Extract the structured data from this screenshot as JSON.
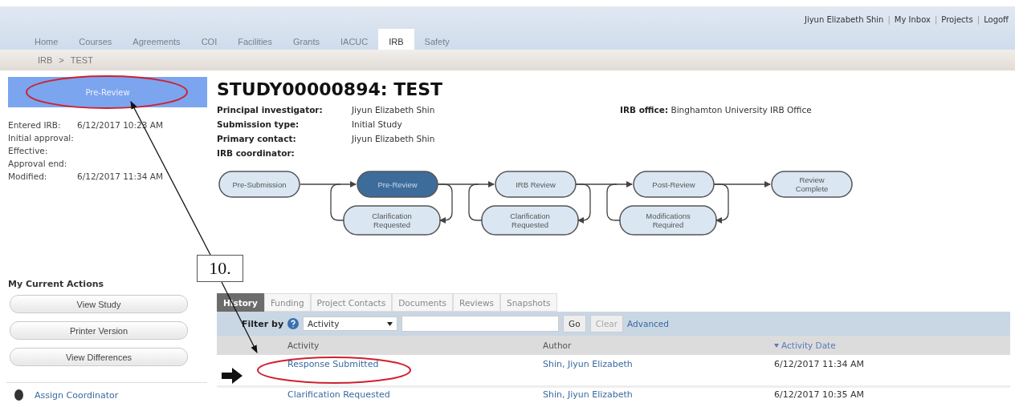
{
  "top_nav": {
    "tabs": [
      {
        "label": "Home",
        "selected": false
      },
      {
        "label": "Courses",
        "selected": false
      },
      {
        "label": "Agreements",
        "selected": false
      },
      {
        "label": "COI",
        "selected": false
      },
      {
        "label": "Facilities",
        "selected": false
      },
      {
        "label": "Grants",
        "selected": false
      },
      {
        "label": "IACUC",
        "selected": false
      },
      {
        "label": "IRB",
        "selected": true
      },
      {
        "label": "Safety",
        "selected": false
      }
    ],
    "user_links": [
      "Jiyun Elizabeth Shin",
      "My Inbox",
      "Projects",
      "Logoff"
    ],
    "link_separator": "|"
  },
  "breadcrumb": {
    "items": [
      "IRB",
      "TEST"
    ],
    "separator": ">"
  },
  "sidebar": {
    "state": "Pre-Review",
    "dates": [
      {
        "label": "Entered IRB:",
        "value": "6/12/2017 10:23 AM"
      },
      {
        "label": "Initial approval:"
      },
      {
        "label": "Effective:"
      },
      {
        "label": "Approval end:"
      },
      {
        "label": "Modified:",
        "value": "6/12/2017 11:34 AM"
      }
    ],
    "actions_title": "My Current Actions",
    "actions": [
      "View Study",
      "Printer Version",
      "View Differences"
    ],
    "activities": [
      "Assign Coordinator"
    ]
  },
  "study": {
    "title": "STUDY00000894: TEST",
    "fields": [
      {
        "label": "Principal investigator:",
        "value": "Jiyun Elizabeth Shin"
      },
      {
        "label": "Submission type:",
        "value": "Initial Study"
      },
      {
        "label": "Primary contact:",
        "value": "Jiyun Elizabeth Shin"
      },
      {
        "label": "IRB coordinator:"
      }
    ],
    "office": {
      "label": "IRB office:",
      "value": "Binghamton University IRB Office"
    }
  },
  "workflow": [
    {
      "label": "Pre-Submission",
      "current": false
    },
    {
      "label": "Pre-Review",
      "current": true,
      "loop": "Clarification Requested"
    },
    {
      "label": "IRB Review",
      "current": false,
      "loop": "Clarification Requested"
    },
    {
      "label": "Post-Review",
      "current": false,
      "loop": "Modifications Required"
    },
    {
      "label": "Review Complete",
      "current": false
    }
  ],
  "detail_tabs": [
    {
      "label": "History",
      "selected": true
    },
    {
      "label": "Funding",
      "selected": false
    },
    {
      "label": "Project Contacts",
      "selected": false
    },
    {
      "label": "Documents",
      "selected": false
    },
    {
      "label": "Reviews",
      "selected": false
    },
    {
      "label": "Snapshots",
      "selected": false
    }
  ],
  "filter": {
    "label": "Filter by",
    "select": "Activity",
    "go": "Go",
    "clear": "Clear",
    "clear_disabled": true,
    "advanced": "Advanced"
  },
  "table": {
    "columns": [
      {
        "label": "Activity",
        "sorted": false
      },
      {
        "label": "Author",
        "sorted": false
      },
      {
        "label": "Activity Date",
        "sorted": true
      }
    ],
    "rows": [
      {
        "activity": "Response Submitted",
        "author": "Shin, Jiyun Elizabeth",
        "date": "6/12/2017 11:34 AM",
        "marked": true
      },
      {
        "activity": "Clarification Requested",
        "author": "Shin, Jiyun Elizabeth",
        "date": "6/12/2017 10:35 AM",
        "marked": false
      }
    ]
  },
  "annotation": {
    "label": "10."
  }
}
